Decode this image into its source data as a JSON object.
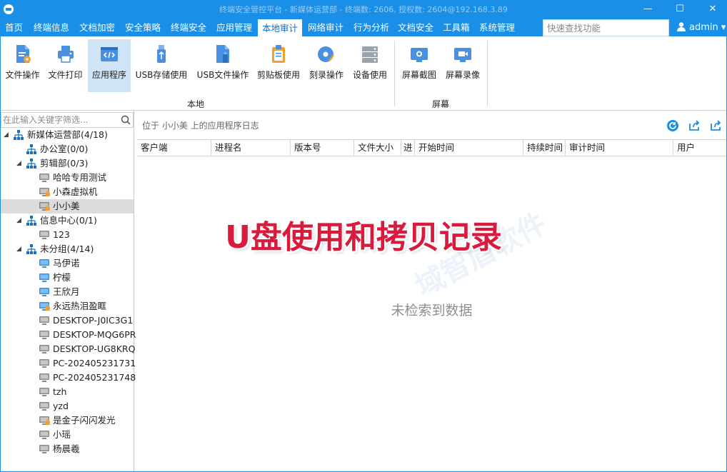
{
  "window": {
    "title": "终端安全管控平台 - 新媒体运营部 - 终端数: 2606, 授权数: 2604@192.168.3.89",
    "minimize_glyph": "—",
    "maximize_glyph": "☐",
    "close_glyph": "✕"
  },
  "menu": {
    "items": [
      {
        "label": "首页",
        "active": false
      },
      {
        "label": "终端信息",
        "active": false
      },
      {
        "label": "文档加密",
        "active": false
      },
      {
        "label": "安全策略",
        "active": false
      },
      {
        "label": "终端安全",
        "active": false
      },
      {
        "label": "应用管理",
        "active": false
      },
      {
        "label": "本地审计",
        "active": true
      },
      {
        "label": "网络审计",
        "active": false
      },
      {
        "label": "行为分析",
        "active": false
      },
      {
        "label": "文档安全",
        "active": false
      },
      {
        "label": "工具箱",
        "active": false
      },
      {
        "label": "系统管理",
        "active": false
      }
    ],
    "search_placeholder": "快速查找功能",
    "user": "admin",
    "user_arrow": "▾"
  },
  "ribbon": {
    "buttons": [
      {
        "label": "文件操作",
        "icon": "file-operation-icon",
        "active": false
      },
      {
        "label": "文件打印",
        "icon": "printer-icon",
        "active": false
      },
      {
        "label": "应用程序",
        "icon": "application-icon",
        "active": true
      },
      {
        "label": "USB存储使用",
        "icon": "usb-storage-icon",
        "active": false
      },
      {
        "label": "USB文件操作",
        "icon": "usb-file-icon",
        "active": false
      },
      {
        "label": "剪贴板使用",
        "icon": "clipboard-icon",
        "active": false
      },
      {
        "label": "刻录操作",
        "icon": "disc-burn-icon",
        "active": false
      },
      {
        "label": "设备使用",
        "icon": "device-icon",
        "active": false
      },
      {
        "label": "屏幕截图",
        "icon": "screenshot-icon",
        "active": false
      },
      {
        "label": "屏幕录像",
        "icon": "screen-record-icon",
        "active": false
      }
    ],
    "groups": {
      "local": "本地",
      "screen": "屏幕"
    }
  },
  "left_panel": {
    "filter_placeholder": "在此输入关键字筛选...",
    "tree": [
      {
        "label": "新媒体运营部(4/18)",
        "type": "org",
        "level": 0,
        "expanded": true
      },
      {
        "label": "办公室(0/0)",
        "type": "org",
        "level": 1,
        "expanded": null
      },
      {
        "label": "剪辑部(0/3)",
        "type": "org",
        "level": 1,
        "expanded": true
      },
      {
        "label": "哈哈专用测试",
        "type": "pc-offline",
        "level": 2,
        "lock": false
      },
      {
        "label": "小森虚拟机",
        "type": "pc-offline",
        "level": 2,
        "lock": true
      },
      {
        "label": "小小美",
        "type": "pc-offline",
        "level": 2,
        "lock": true,
        "selected": true
      },
      {
        "label": "信息中心(0/1)",
        "type": "org",
        "level": 1,
        "expanded": true
      },
      {
        "label": "123",
        "type": "pc-offline",
        "level": 2,
        "lock": false
      },
      {
        "label": "未分组(4/14)",
        "type": "org",
        "level": 1,
        "expanded": true
      },
      {
        "label": "马伊诺",
        "type": "pc-online",
        "level": 2,
        "lock": false
      },
      {
        "label": "柠檬",
        "type": "pc-online",
        "level": 2,
        "lock": false
      },
      {
        "label": "王欣月",
        "type": "pc-online",
        "level": 2,
        "lock": false
      },
      {
        "label": "永远热泪盈眶",
        "type": "pc-online",
        "level": 2,
        "lock": true
      },
      {
        "label": "DESKTOP-J0IC3G1",
        "type": "pc-offline",
        "level": 2,
        "lock": false
      },
      {
        "label": "DESKTOP-MQG6PR",
        "type": "pc-offline",
        "level": 2,
        "lock": false
      },
      {
        "label": "DESKTOP-UG8KRQ",
        "type": "pc-offline",
        "level": 2,
        "lock": false
      },
      {
        "label": "PC-202405231731",
        "type": "pc-offline",
        "level": 2,
        "lock": false
      },
      {
        "label": "PC-202405231748",
        "type": "pc-offline",
        "level": 2,
        "lock": false
      },
      {
        "label": "tzh",
        "type": "pc-offline",
        "level": 2,
        "lock": false
      },
      {
        "label": "yzd",
        "type": "pc-offline",
        "level": 2,
        "lock": false
      },
      {
        "label": "是金子闪闪发光",
        "type": "pc-offline",
        "level": 2,
        "lock": true
      },
      {
        "label": "小瑶",
        "type": "pc-offline",
        "level": 2,
        "lock": false
      },
      {
        "label": "杨晨羲",
        "type": "pc-offline",
        "level": 2,
        "lock": false
      }
    ]
  },
  "content": {
    "location": "位于 小小美 上的应用程序日志",
    "columns": [
      "客户端",
      "进程名",
      "版本号",
      "文件大小",
      "进",
      "开始时间",
      "持续时间",
      "审计时间",
      "用户"
    ],
    "empty_text": "未检索到数据",
    "watermark": "域智盾软件"
  },
  "overlay_caption": "U盘使用和拷贝记录",
  "colors": {
    "accent": "#1a8fe8",
    "overlay": "#d81a3c",
    "selected": "#dcdcdc"
  }
}
